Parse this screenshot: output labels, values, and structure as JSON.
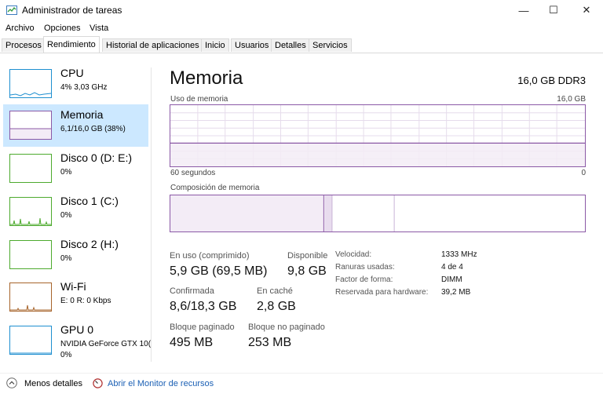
{
  "window": {
    "title": "Administrador de tareas",
    "minimize_glyph": "—",
    "maximize_glyph": "☐",
    "close_glyph": "✕"
  },
  "menu": [
    "Archivo",
    "Opciones",
    "Vista"
  ],
  "tabs": [
    "Procesos",
    "Rendimiento",
    "Historial de aplicaciones",
    "Inicio",
    "Usuarios",
    "Detalles",
    "Servicios"
  ],
  "active_tab": "Rendimiento",
  "resources": [
    {
      "name": "CPU",
      "sub": "4% 3,03 GHz",
      "sub2": "",
      "color": "#1e8fd0"
    },
    {
      "name": "Memoria",
      "sub": "6,1/16,0 GB (38%)",
      "sub2": "",
      "color": "#8b59a6"
    },
    {
      "name": "Disco 0 (D: E:)",
      "sub": "0%",
      "sub2": "",
      "color": "#4daa2e"
    },
    {
      "name": "Disco 1 (C:)",
      "sub": "0%",
      "sub2": "",
      "color": "#4daa2e"
    },
    {
      "name": "Disco 2 (H:)",
      "sub": "0%",
      "sub2": "",
      "color": "#4daa2e"
    },
    {
      "name": "Wi-Fi",
      "sub": "E: 0 R: 0 Kbps",
      "sub2": "",
      "color": "#a7642b"
    },
    {
      "name": "GPU 0",
      "sub": "NVIDIA GeForce GTX 10(",
      "sub2": "0%",
      "color": "#1e8fd0"
    }
  ],
  "selected_resource": "Memoria",
  "main": {
    "title": "Memoria",
    "spec": "16,0 GB DDR3",
    "usage_label": "Uso de memoria",
    "usage_max": "16,0 GB",
    "time_left": "60 segundos",
    "time_right": "0",
    "usage_fraction": 0.38,
    "composition_label": "Composición de memoria",
    "composition": {
      "in_use_fraction": 0.37,
      "modified_fraction": 0.02,
      "standby_fraction": 0.15
    }
  },
  "stats": {
    "in_use_label": "En uso (comprimido)",
    "in_use_value": "5,9 GB (69,5 MB)",
    "available_label": "Disponible",
    "available_value": "9,8 GB",
    "committed_label": "Confirmada",
    "committed_value": "8,6/18,3 GB",
    "cached_label": "En caché",
    "cached_value": "2,8 GB",
    "paged_label": "Bloque paginado",
    "paged_value": "495 MB",
    "nonpaged_label": "Bloque no paginado",
    "nonpaged_value": "253 MB"
  },
  "specs": [
    {
      "label": "Velocidad:",
      "value": "1333 MHz"
    },
    {
      "label": "Ranuras usadas:",
      "value": "4 de 4"
    },
    {
      "label": "Factor de forma:",
      "value": "DIMM"
    },
    {
      "label": "Reservada para hardware:",
      "value": "39,2 MB"
    }
  ],
  "footer": {
    "fewer_details": "Menos detalles",
    "resource_monitor": "Abrir el Monitor de recursos"
  },
  "colors": {
    "memory": "#8b59a6",
    "memory_fill": "#f3ecf6",
    "selection": "#cce8ff",
    "link": "#1a5fb4"
  }
}
